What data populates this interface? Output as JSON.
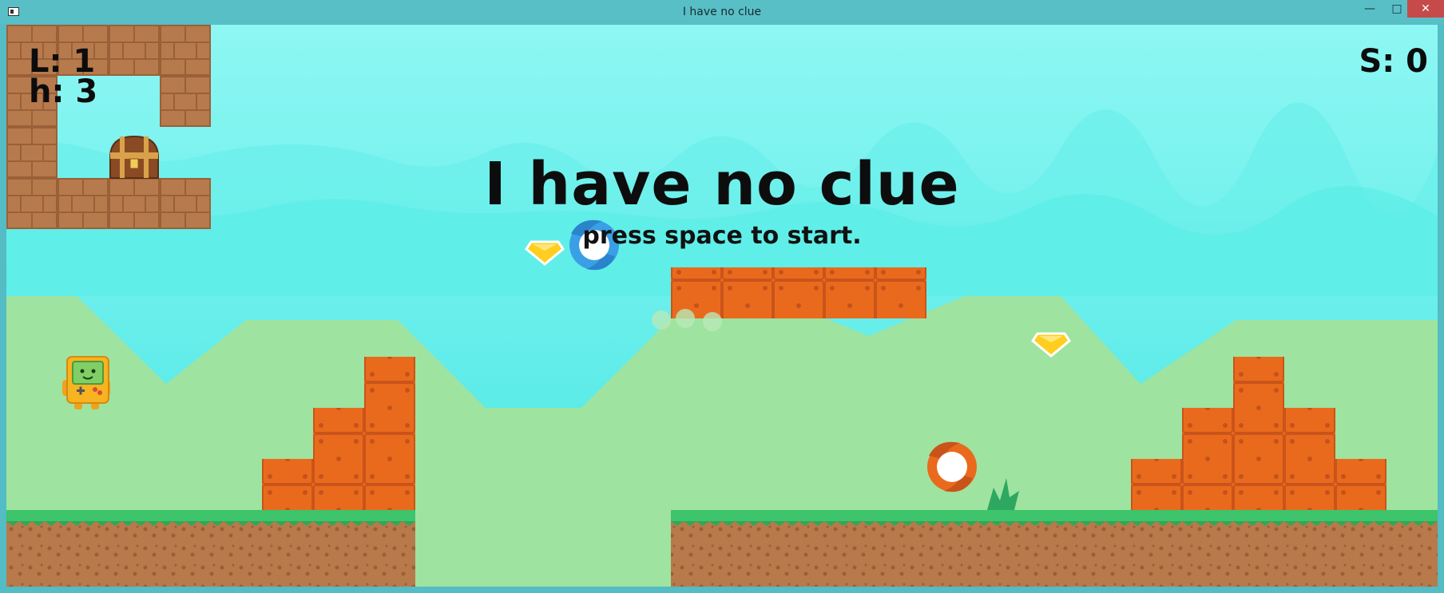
{
  "window": {
    "title": "I have no clue",
    "minimize_label": "—",
    "maximize_label": "□",
    "close_label": "✕"
  },
  "hud": {
    "lives": "L: 1",
    "hearts": "h: 3",
    "score": "S: 0"
  },
  "menu": {
    "title": "I have no clue",
    "subtitle": "press space to start."
  },
  "colors": {
    "sky": "#5eeee8",
    "hills": "#9fe3a0",
    "brick": "#b77a4c",
    "orange_block": "#e8671b",
    "grass": "#3ec46a",
    "dirt": "#b8794b",
    "gem": "#ffce1f"
  },
  "icons": {
    "treasure": "treasure-chest-icon",
    "gem": "gem-icon",
    "player": "handheld-console-character-icon",
    "portal_blue": "blue-swirl-portal-icon",
    "portal_orange": "orange-swirl-portal-icon",
    "bush": "bush-icon"
  }
}
